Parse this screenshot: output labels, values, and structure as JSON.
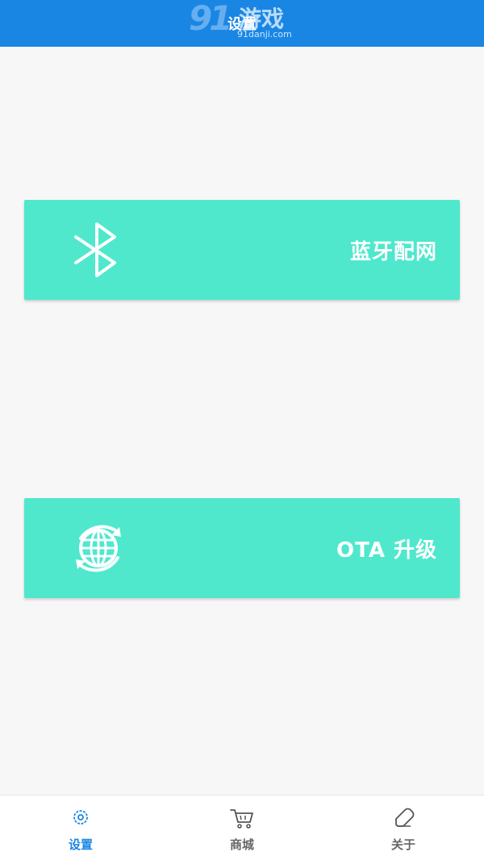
{
  "header": {
    "title": "设置",
    "watermark": {
      "logo_number": "91",
      "logo_text": "游戏",
      "domain": "91danji.com"
    }
  },
  "colors": {
    "header_bg": "#1a86e4",
    "card_bg": "#4fe8cd",
    "active_tab": "#1a86e4",
    "inactive_tab": "#666666",
    "page_bg": "#f7f7f7"
  },
  "actions": [
    {
      "label": "蓝牙配网",
      "icon": "bluetooth-icon"
    },
    {
      "label": "OTA 升级",
      "icon": "globe-sync-icon"
    }
  ],
  "bottom_nav": {
    "active_index": 0,
    "items": [
      {
        "label": "设置",
        "icon": "gear-icon"
      },
      {
        "label": "商城",
        "icon": "cart-icon"
      },
      {
        "label": "关于",
        "icon": "tag-icon"
      }
    ]
  }
}
